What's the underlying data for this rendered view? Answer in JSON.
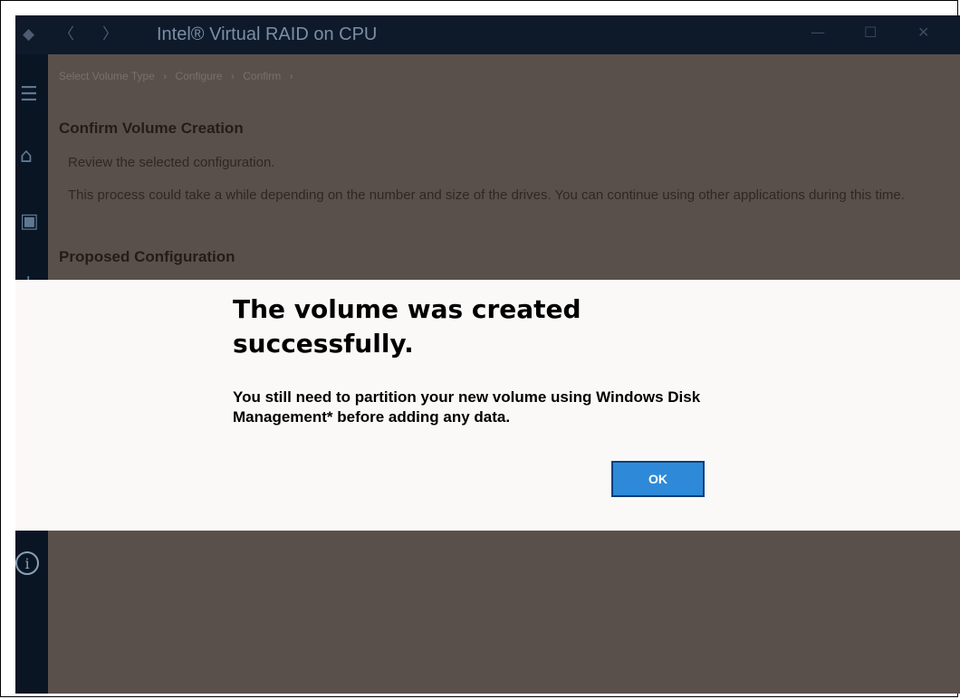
{
  "window": {
    "title": "Intel® Virtual RAID on CPU",
    "minimize_glyph": "—",
    "maximize_glyph": "☐",
    "close_glyph": "✕"
  },
  "nav": {
    "back_glyph": "〈",
    "forward_glyph": "〉"
  },
  "breadcrumb": {
    "items": [
      "Select Volume Type",
      "Configure",
      "Confirm"
    ],
    "separator": "›"
  },
  "page": {
    "heading": "Confirm Volume Creation",
    "review_text": "Review the selected configuration.",
    "process_text": "This process could take a while depending on the number and size of the drives. You can continue using other applications during this time.",
    "proposed_heading": "Proposed Configuration"
  },
  "sidebar": {
    "icons": [
      "menu-icon",
      "home-icon",
      "volume-icon",
      "add-icon",
      "info-icon"
    ]
  },
  "modal": {
    "title": "The volume was created successfully.",
    "message": "You still need to partition your new volume using Windows Disk Management* before adding any data.",
    "ok_label": "OK"
  },
  "colors": {
    "overlay": "#5a504b",
    "titlebar": "#0e1a2a",
    "modal_bg": "#fbf9f8",
    "ok_button": "#2e8ad8"
  }
}
